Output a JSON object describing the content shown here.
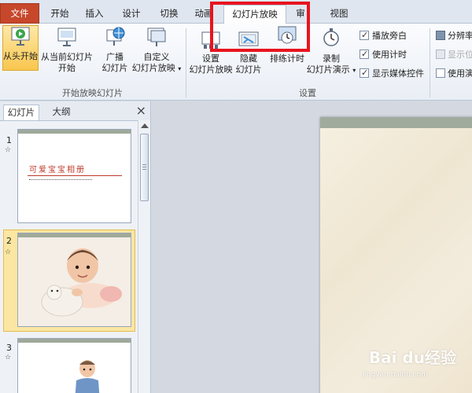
{
  "tabs": {
    "file": "文件",
    "home": "开始",
    "insert": "插入",
    "design": "设计",
    "transitions": "切换",
    "animations": "动画",
    "slideshow": "幻灯片放映",
    "review": "审阅",
    "view": "视图"
  },
  "ribbon": {
    "start_group": {
      "from_beginning": "从头开始",
      "from_current_1": "从当前幻灯片",
      "from_current_2": "开始",
      "broadcast_1": "广播",
      "broadcast_2": "幻灯片",
      "custom_1": "自定义",
      "custom_2": "幻灯片放映",
      "label": "开始放映幻灯片"
    },
    "setup_group": {
      "setup_1": "设置",
      "setup_2": "幻灯片放映",
      "hide_1": "隐藏",
      "hide_2": "幻灯片",
      "rehearse": "排练计时",
      "record_1": "录制",
      "record_2": "幻灯片演示",
      "label": "设置",
      "play_narration": "播放旁白",
      "use_timings": "使用计时",
      "show_media_controls": "显示媒体控件"
    },
    "monitors_group": {
      "resolution": "分辨率",
      "show_on": "显示位",
      "use_presenter": "使用演"
    }
  },
  "panel": {
    "tab_slides": "幻灯片",
    "tab_outline": "大纲",
    "close": "×",
    "slides": [
      {
        "num": "1",
        "title": "可爱宝宝相册"
      },
      {
        "num": "2"
      },
      {
        "num": "3"
      }
    ]
  },
  "watermark": {
    "brand": "Bai du经验",
    "url": "jingyan.baidu.com"
  },
  "colors": {
    "file_tab": "#c7472b",
    "highlight": "#e8141e",
    "selected": "#f9c64e"
  }
}
